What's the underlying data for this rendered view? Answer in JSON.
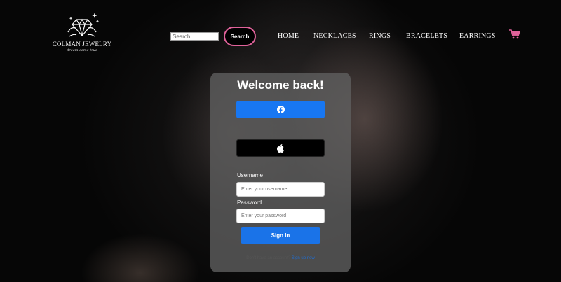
{
  "brand": {
    "name": "COLMAN JEWELRY",
    "tagline": "dream come true",
    "logo_icon": "diamond-icon"
  },
  "header": {
    "search_placeholder": "Search",
    "search_value": "",
    "search_button_label": "Search",
    "nav": [
      {
        "label": "HOME"
      },
      {
        "label": "NECKLACES"
      },
      {
        "label": "RINGS"
      },
      {
        "label": "BRACELETS"
      },
      {
        "label": "EARRINGS"
      }
    ],
    "cart_icon": "cart-icon"
  },
  "login": {
    "title": "Welcome back!",
    "facebook_icon": "facebook-icon",
    "apple_icon": "apple-icon",
    "username_label": "Username",
    "username_placeholder": "Enter your username",
    "username_value": "",
    "password_label": "Password",
    "password_placeholder": "Enter your password",
    "password_value": "",
    "signin_label": "Sign In",
    "no_account_text": "Don't have an account?",
    "signup_link_text": "Sign up now"
  },
  "colors": {
    "accent_pink": "#e0629a",
    "facebook_blue": "#1877f2",
    "signin_blue": "#1a73e8",
    "link_blue": "#1f6fd6"
  }
}
